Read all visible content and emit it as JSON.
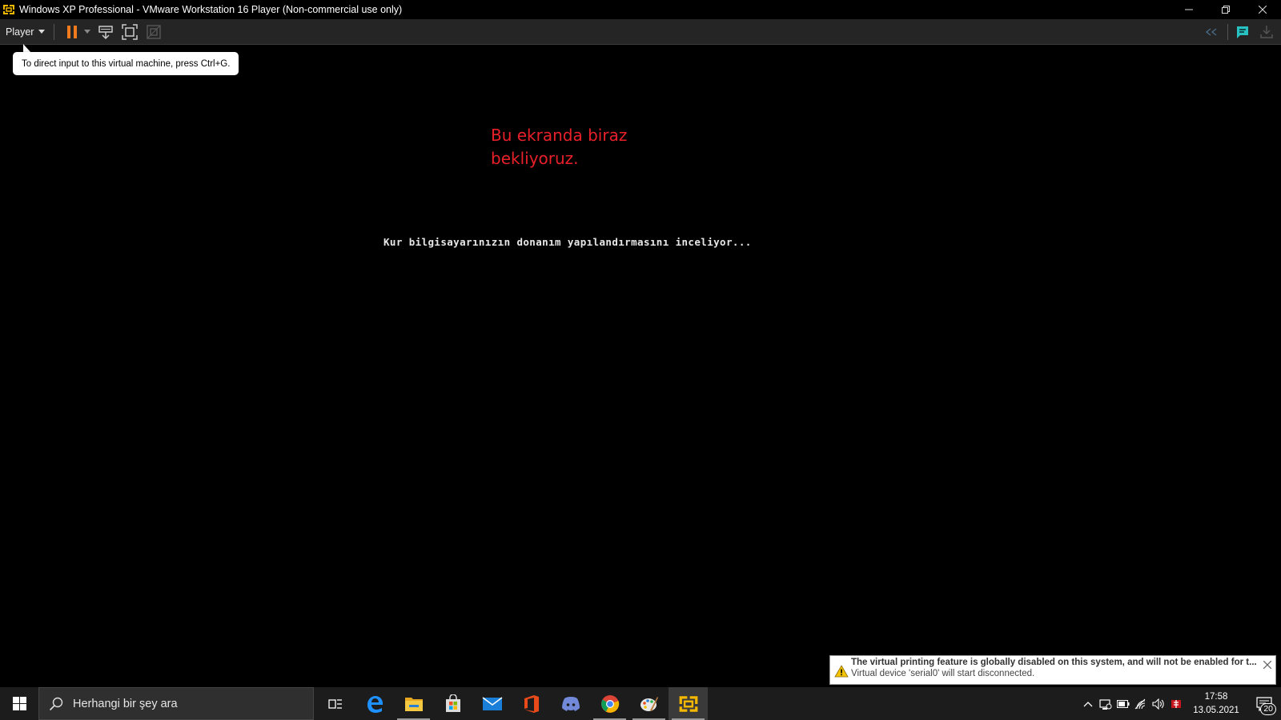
{
  "window": {
    "title": "Windows XP Professional - VMware Workstation 16 Player (Non-commercial use only)"
  },
  "toolbar": {
    "player_label": "Player"
  },
  "tooltip": {
    "text": "To direct input to this virtual machine, press Ctrl+G."
  },
  "vm": {
    "annotation": "Bu ekranda biraz bekliyoruz.",
    "setup_status": "Kur bilgisayarınızın donanım yapılandırmasını inceliyor..."
  },
  "notification": {
    "title": "The virtual printing feature is globally disabled on this system, and will not be enabled for t...",
    "subtitle": "Virtual device 'serial0' will start disconnected."
  },
  "taskbar": {
    "search_placeholder": "Herhangi bir şey ara",
    "apps": [
      "task-view",
      "edge",
      "file-explorer",
      "store",
      "mail",
      "office",
      "discord",
      "chrome",
      "paint",
      "vmware"
    ],
    "time": "17:58",
    "date": "13.05.2021",
    "notification_count": "20"
  },
  "colors": {
    "annotation": "#e8202a",
    "pause_orange": "#f07a1e",
    "accent_teal": "#28c0c0"
  }
}
